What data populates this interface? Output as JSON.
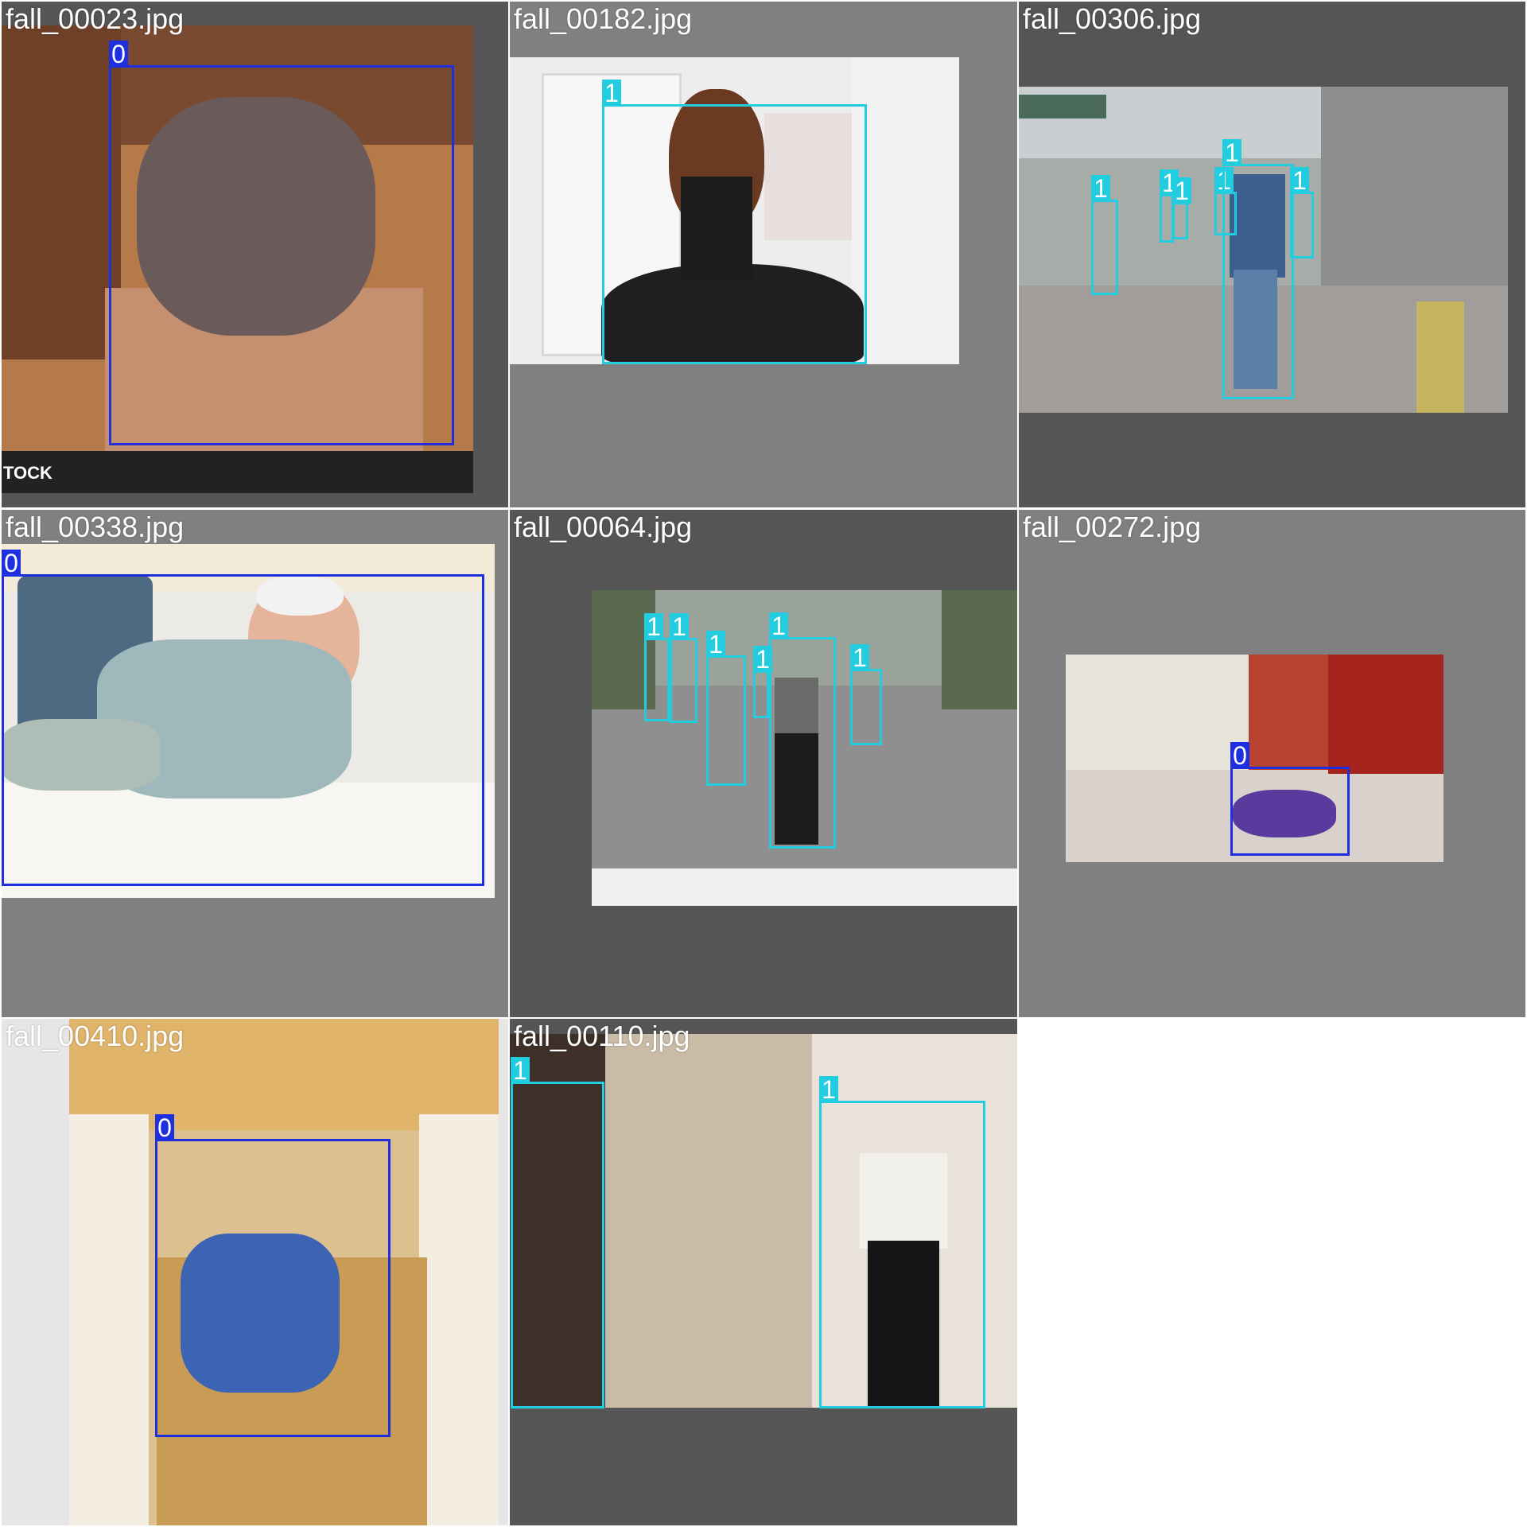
{
  "colors": {
    "class_0": "#1e2fe0",
    "class_1": "#23cde0",
    "tile_gray": "#808080",
    "tile_dark": "#555555"
  },
  "tiles": [
    {
      "filename": "fall_00023.jpg",
      "watermark_left": "TOCK",
      "detections": [
        {
          "cls": "0",
          "label": "0"
        }
      ]
    },
    {
      "filename": "fall_00182.jpg",
      "detections": [
        {
          "cls": "1",
          "label": "1"
        }
      ]
    },
    {
      "filename": "fall_00306.jpg",
      "detections": [
        {
          "cls": "1",
          "label": "1"
        },
        {
          "cls": "1",
          "label": "1"
        },
        {
          "cls": "1",
          "label": "1"
        },
        {
          "cls": "1",
          "label": "1"
        },
        {
          "cls": "1",
          "label": "1"
        },
        {
          "cls": "1",
          "label": "1"
        }
      ]
    },
    {
      "filename": "fall_00338.jpg",
      "detections": [
        {
          "cls": "0",
          "label": "0"
        }
      ]
    },
    {
      "filename": "fall_00064.jpg",
      "detections": [
        {
          "cls": "1",
          "label": "1"
        },
        {
          "cls": "1",
          "label": "1"
        },
        {
          "cls": "1",
          "label": "1"
        },
        {
          "cls": "1",
          "label": "1"
        },
        {
          "cls": "1",
          "label": "1"
        },
        {
          "cls": "1",
          "label": "1"
        }
      ]
    },
    {
      "filename": "fall_00272.jpg",
      "detections": [
        {
          "cls": "0",
          "label": "0"
        }
      ]
    },
    {
      "filename": "fall_00410.jpg",
      "detections": [
        {
          "cls": "0",
          "label": "0"
        }
      ]
    },
    {
      "filename": "fall_00110.jpg",
      "detections": [
        {
          "cls": "1",
          "label": "1"
        },
        {
          "cls": "1",
          "label": "1"
        }
      ]
    }
  ]
}
